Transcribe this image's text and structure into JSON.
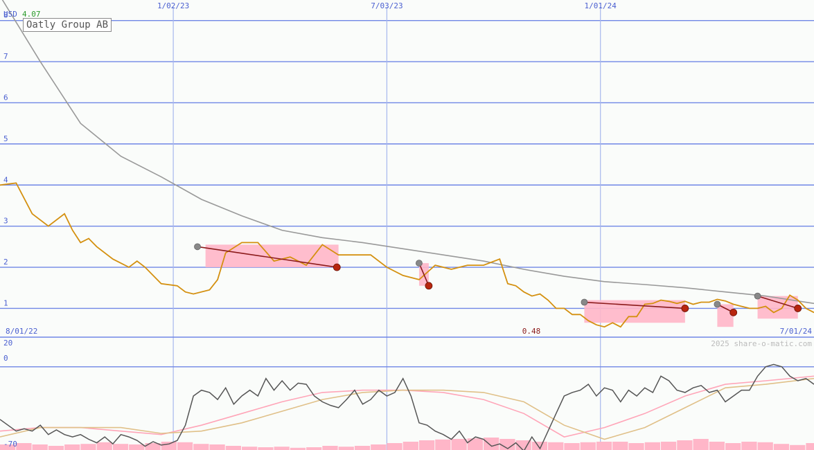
{
  "colors": {
    "background": "#fafcfa",
    "grid": "#a7b7ee",
    "grid_major": "#6f86e6",
    "price": "#d4900f",
    "moving_average": "#999999",
    "highlight_pink": "#ffb6c8",
    "highlight_green": "#8ed84a",
    "trend_line": "#8b1a1a",
    "marker_red": "#b8260f",
    "marker_gray": "#888888",
    "osc_dark": "#555555",
    "osc_pink": "#ffa5b8",
    "osc_tan": "#e0c088",
    "volume": "#ffb6c8"
  },
  "header": {
    "currency": "USD",
    "last_value": "4.07",
    "company": "Oatly Group AB"
  },
  "footer": {
    "start_date": "8/01/22",
    "end_date": "7/01/24",
    "min_value": "0.48",
    "credit": "2025 share-o-matic.com"
  },
  "chart_data": [
    {
      "type": "line",
      "title": "Oatly Group AB",
      "ylabel": "USD",
      "ylim": [
        0.3,
        8.5
      ],
      "yticks": [
        "8",
        "7",
        "6",
        "5",
        "4",
        "3",
        "2",
        "1"
      ],
      "xticks": [
        "1/02/23",
        "7/03/23",
        "1/01/24"
      ],
      "x_range": [
        "8/01/22",
        "7/01/24"
      ],
      "grid": true,
      "series": [
        {
          "role": "price",
          "x": [
            0,
            2,
            4,
            6,
            8,
            9,
            10,
            11,
            12,
            14,
            16,
            17,
            18,
            20,
            22,
            23,
            24,
            26,
            27,
            28,
            30,
            32,
            34,
            36,
            38,
            40,
            42,
            44,
            46,
            48,
            50,
            52,
            54,
            56,
            58,
            60,
            62,
            63,
            64,
            65,
            66,
            67,
            68,
            69,
            70,
            71,
            72,
            73,
            74,
            75,
            76,
            77,
            78,
            79,
            80,
            81,
            82,
            83,
            84,
            85,
            86,
            87,
            88,
            89,
            90,
            91,
            92,
            93,
            94,
            95,
            96,
            97,
            98,
            99,
            100,
            101
          ],
          "values": [
            4.0,
            4.05,
            3.3,
            3.0,
            3.3,
            2.9,
            2.6,
            2.7,
            2.5,
            2.2,
            2.0,
            2.15,
            2.0,
            1.6,
            1.55,
            1.4,
            1.35,
            1.45,
            1.7,
            2.35,
            2.6,
            2.6,
            2.15,
            2.25,
            2.05,
            2.55,
            2.3,
            2.3,
            2.3,
            2.0,
            1.8,
            1.7,
            2.05,
            1.95,
            2.05,
            2.05,
            2.2,
            1.6,
            1.55,
            1.4,
            1.3,
            1.35,
            1.2,
            1.0,
            1.0,
            0.85,
            0.85,
            0.7,
            0.6,
            0.55,
            0.65,
            0.55,
            0.8,
            0.8,
            1.1,
            1.12,
            1.2,
            1.17,
            1.12,
            1.17,
            1.1,
            1.15,
            1.15,
            1.22,
            1.18,
            1.1,
            1.05,
            1.0,
            1.0,
            1.05,
            0.9,
            1.0,
            1.32,
            1.2,
            1.0,
            0.9
          ]
        },
        {
          "role": "moving_average",
          "x": [
            0,
            5,
            10,
            15,
            20,
            25,
            30,
            35,
            40,
            45,
            50,
            55,
            60,
            65,
            70,
            75,
            80,
            85,
            90,
            95,
            101
          ],
          "values": [
            8.6,
            7.0,
            5.5,
            4.7,
            4.2,
            3.65,
            3.25,
            2.9,
            2.72,
            2.6,
            2.45,
            2.3,
            2.15,
            1.95,
            1.78,
            1.65,
            1.58,
            1.5,
            1.4,
            1.3,
            1.12
          ]
        }
      ],
      "annotations": {
        "trend_segments": [
          {
            "from": [
              24.5,
              2.5
            ],
            "to": [
              41.8,
              2.0
            ]
          },
          {
            "from": [
              52.0,
              2.1
            ],
            "to": [
              53.2,
              1.55
            ]
          },
          {
            "from": [
              72.5,
              1.15
            ],
            "to": [
              85.0,
              1.0
            ]
          },
          {
            "from": [
              89.0,
              1.1
            ],
            "to": [
              91.0,
              0.9
            ]
          },
          {
            "from": [
              94.0,
              1.3
            ],
            "to": [
              99.0,
              1.0
            ]
          }
        ],
        "pink_zones": [
          {
            "x": [
              25.5,
              42.0
            ],
            "top": 2.55
          },
          {
            "x": [
              52.0,
              53.2
            ],
            "top": 2.1
          },
          {
            "x": [
              72.5,
              85.0
            ],
            "top": 1.2
          },
          {
            "x": [
              89.0,
              91.0
            ],
            "top": 1.1
          },
          {
            "x": [
              94.0,
              99.0
            ],
            "top": 1.3
          }
        ],
        "markers_gray": [
          [
            24.5,
            2.5
          ],
          [
            52.0,
            2.1
          ],
          [
            72.5,
            1.15
          ],
          [
            89.0,
            1.1
          ],
          [
            94.0,
            1.3
          ]
        ],
        "markers_red": [
          [
            41.8,
            2.0
          ],
          [
            53.2,
            1.55
          ],
          [
            85.0,
            1.0
          ],
          [
            91.0,
            0.9
          ],
          [
            99.0,
            1.0
          ]
        ]
      }
    },
    {
      "type": "line",
      "ylim": [
        -70,
        20
      ],
      "yticks": [
        "20",
        "0",
        "-70"
      ],
      "series": [
        {
          "role": "oscillator_fast",
          "x": [
            0,
            2,
            3,
            4,
            5,
            6,
            7,
            8,
            9,
            10,
            11,
            12,
            13,
            14,
            15,
            16,
            17,
            18,
            19,
            20,
            21,
            22,
            23,
            24,
            25,
            26,
            27,
            28,
            29,
            30,
            31,
            32,
            33,
            34,
            35,
            36,
            37,
            38,
            39,
            40,
            41,
            42,
            43,
            44,
            45,
            46,
            47,
            48,
            49,
            50,
            51,
            52,
            53,
            54,
            55,
            56,
            57,
            58,
            59,
            60,
            61,
            62,
            63,
            64,
            65,
            66,
            67,
            68,
            69,
            70,
            71,
            72,
            73,
            74,
            75,
            76,
            77,
            78,
            79,
            80,
            81,
            82,
            83,
            84,
            85,
            86,
            87,
            88,
            89,
            90,
            91,
            92,
            93,
            94,
            95,
            96,
            97,
            98,
            99,
            100,
            101
          ],
          "values": [
            -45,
            -55,
            -53,
            -55,
            -50,
            -58,
            -54,
            -58,
            -60,
            -58,
            -62,
            -65,
            -60,
            -66,
            -58,
            -60,
            -63,
            -68,
            -64,
            -67,
            -66,
            -63,
            -50,
            -25,
            -20,
            -22,
            -28,
            -18,
            -32,
            -25,
            -20,
            -25,
            -10,
            -20,
            -12,
            -20,
            -14,
            -15,
            -25,
            -30,
            -33,
            -35,
            -28,
            -20,
            -32,
            -28,
            -20,
            -25,
            -22,
            -10,
            -25,
            -48,
            -50,
            -55,
            -58,
            -62,
            -55,
            -65,
            -60,
            -62,
            -68,
            -66,
            -70,
            -65,
            -72,
            -60,
            -70,
            -55,
            -40,
            -25,
            -22,
            -20,
            -15,
            -25,
            -18,
            -20,
            -30,
            -20,
            -25,
            -18,
            -22,
            -8,
            -12,
            -20,
            -22,
            -18,
            -16,
            -22,
            -20,
            -30,
            -25,
            -20,
            -20,
            -8,
            0,
            2,
            0,
            -8,
            -12,
            -10,
            -15
          ]
        },
        {
          "role": "oscillator_slow",
          "x": [
            0,
            5,
            10,
            15,
            20,
            25,
            30,
            35,
            40,
            45,
            50,
            55,
            60,
            65,
            70,
            75,
            80,
            85,
            90,
            95,
            101
          ],
          "values": [
            -55,
            -52,
            -52,
            -55,
            -58,
            -50,
            -40,
            -30,
            -22,
            -20,
            -20,
            -22,
            -28,
            -40,
            -60,
            -52,
            -40,
            -25,
            -15,
            -12,
            -8
          ]
        },
        {
          "role": "oscillator_signal",
          "x": [
            0,
            5,
            10,
            15,
            20,
            25,
            30,
            35,
            40,
            45,
            50,
            55,
            60,
            65,
            70,
            75,
            80,
            85,
            90,
            95,
            101
          ],
          "values": [
            -60,
            -52,
            -52,
            -52,
            -57,
            -55,
            -48,
            -38,
            -28,
            -22,
            -20,
            -20,
            -22,
            -30,
            -50,
            -62,
            -52,
            -35,
            -18,
            -15,
            -10
          ]
        }
      ],
      "volume": {
        "x": [
          0,
          2,
          4,
          6,
          8,
          10,
          12,
          14,
          16,
          18,
          20,
          22,
          24,
          26,
          28,
          30,
          32,
          34,
          36,
          38,
          40,
          42,
          44,
          46,
          48,
          50,
          52,
          54,
          56,
          58,
          60,
          62,
          64,
          66,
          68,
          70,
          72,
          74,
          76,
          78,
          80,
          82,
          84,
          86,
          88,
          90,
          92,
          94,
          96,
          98,
          100
        ],
        "values": [
          20,
          25,
          20,
          15,
          20,
          22,
          28,
          22,
          20,
          25,
          30,
          28,
          22,
          20,
          15,
          12,
          10,
          12,
          8,
          10,
          15,
          12,
          15,
          20,
          25,
          30,
          35,
          38,
          40,
          42,
          45,
          40,
          35,
          30,
          28,
          25,
          28,
          30,
          30,
          25,
          28,
          30,
          35,
          40,
          30,
          25,
          30,
          28,
          22,
          18,
          25
        ]
      }
    }
  ]
}
